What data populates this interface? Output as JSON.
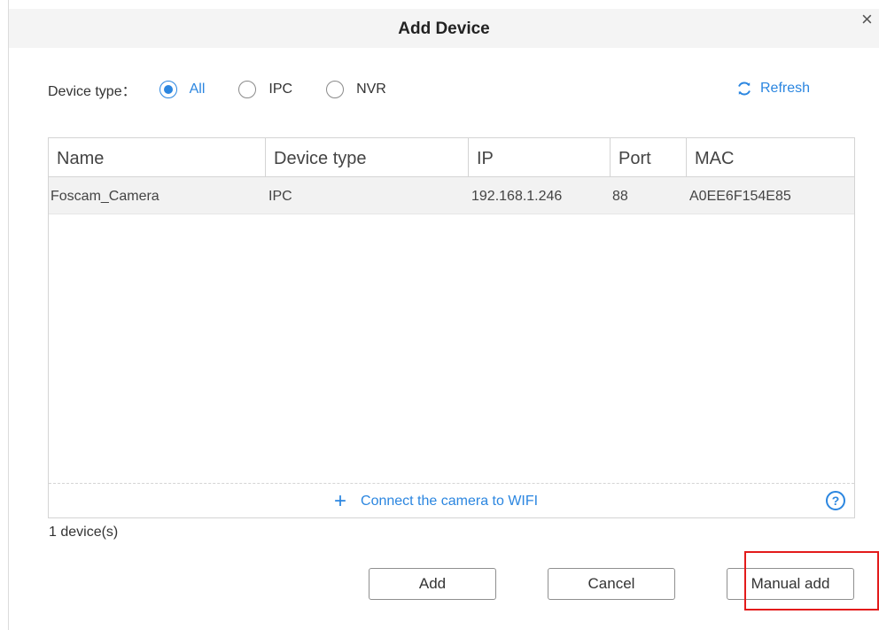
{
  "dialog": {
    "title": "Add Device",
    "close_symbol": "×",
    "close_icon": "close-icon"
  },
  "filter": {
    "label": "Device type：",
    "options": [
      {
        "label": "All",
        "checked": true
      },
      {
        "label": "IPC",
        "checked": false
      },
      {
        "label": "NVR",
        "checked": false
      }
    ]
  },
  "refresh": {
    "label": "Refresh",
    "icon": "refresh-icon"
  },
  "table": {
    "columns": [
      "Name",
      "Device type",
      "IP",
      "Port",
      "MAC"
    ],
    "rows": [
      {
        "name": "Foscam_Camera",
        "type": "IPC",
        "ip": "192.168.1.246",
        "port": "88",
        "mac": "A0EE6F154E85"
      }
    ]
  },
  "connect": {
    "plus_symbol": "+",
    "label": "Connect the camera to WIFI",
    "help_symbol": "?",
    "help_icon": "help-icon"
  },
  "footer": {
    "count_text": "1 device(s)",
    "add_label": "Add",
    "cancel_label": "Cancel",
    "manual_label": "Manual add"
  },
  "colors": {
    "accent": "#2b86e0",
    "highlight": "#e31b1b",
    "row_bg": "#f2f2f2",
    "title_bar": "#f4f4f4"
  }
}
